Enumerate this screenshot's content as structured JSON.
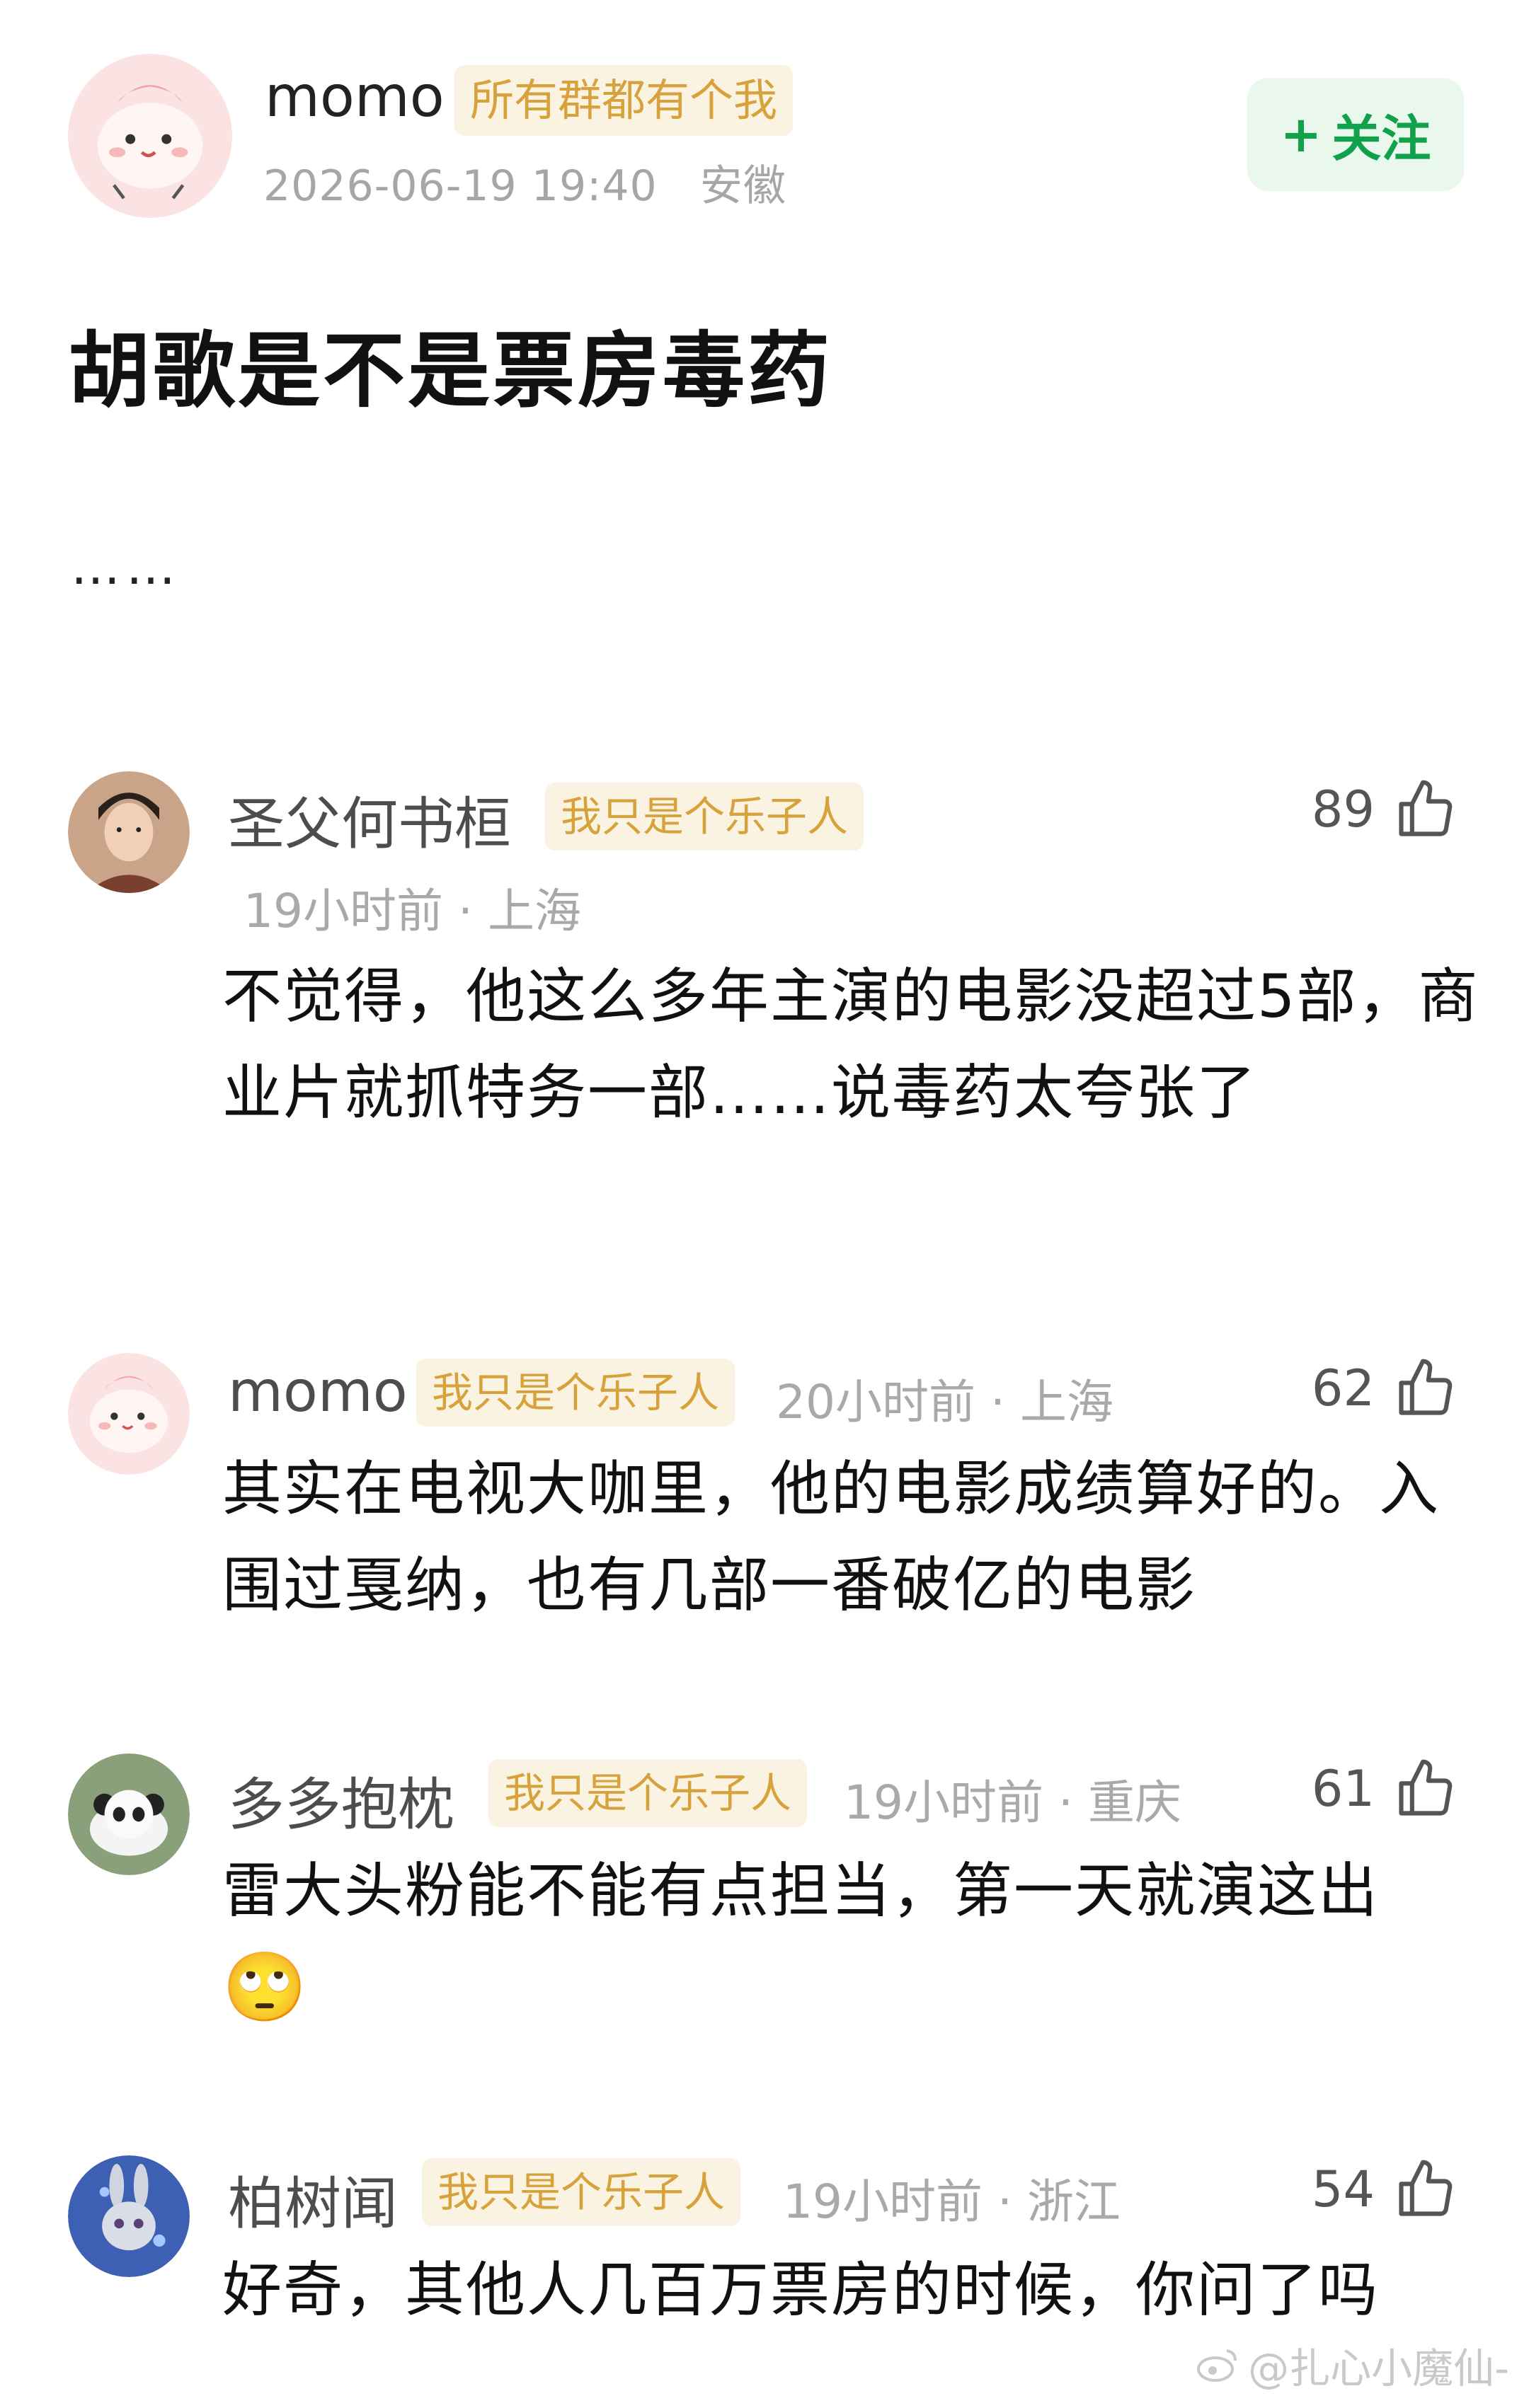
{
  "post": {
    "author": "momo",
    "badge": "所有群都有个我",
    "date": "2026-06-19 19:40",
    "location": "安徽",
    "follow_label": "关注",
    "follow_plus": "+",
    "title": "胡歌是不是票房毒药",
    "body": "……"
  },
  "comments": [
    {
      "name": "圣父何书桓",
      "badge": "我只是个乐子人",
      "time": "19小时前",
      "sep": "·",
      "location": "上海",
      "likes": "89",
      "text": "不觉得，他这么多年主演的电影没超过5部，商业片就抓特务一部……说毒药太夸张了"
    },
    {
      "name": "momo",
      "badge": "我只是个乐子人",
      "time": "20小时前",
      "sep": "·",
      "location": "上海",
      "likes": "62",
      "text": "其实在电视大咖里，他的电影成绩算好的。入围过戛纳，也有几部一番破亿的电影"
    },
    {
      "name": "多多抱枕",
      "badge": "我只是个乐子人",
      "time": "19小时前",
      "sep": "·",
      "location": "重庆",
      "likes": "61",
      "text": "雷大头粉能不能有点担当，第一天就演这出",
      "emoji": "🙄"
    },
    {
      "name": "柏树闻",
      "badge": "我只是个乐子人",
      "time": "19小时前",
      "sep": "·",
      "location": "浙江",
      "likes": "54",
      "text": "好奇，其他人几百万票房的时候，你问了吗"
    }
  ],
  "watermark": "@扎心小魔仙-",
  "icons": {
    "thumb": "thumbs-up-icon",
    "weibo": "weibo-logo-icon"
  }
}
